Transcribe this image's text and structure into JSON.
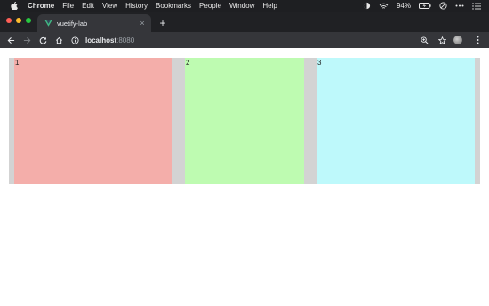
{
  "menubar": {
    "app_name": "Chrome",
    "items": [
      "File",
      "Edit",
      "View",
      "History",
      "Bookmarks",
      "People",
      "Window",
      "Help"
    ],
    "battery": "94%"
  },
  "tab": {
    "title": "vuetify-lab",
    "close_glyph": "×"
  },
  "new_tab_glyph": "+",
  "omnibox": {
    "host": "localhost",
    "port": ":8080"
  },
  "page": {
    "cells": [
      {
        "label": "1",
        "color": "#f4aeaa"
      },
      {
        "label": "2",
        "color": "#befbb1"
      },
      {
        "label": "3",
        "color": "#bef9fb"
      }
    ],
    "gutter_color": "#d3d3d3"
  },
  "colors": {
    "menubar_bg": "#1e1f22",
    "tabstrip_bg": "#202124",
    "toolbar_bg": "#35363a"
  },
  "icons": {
    "apple": "apple-icon",
    "vue_favicon": "vue-logo-icon",
    "back": "back-arrow-icon",
    "forward": "forward-arrow-icon",
    "reload": "reload-icon",
    "home": "home-icon",
    "info": "info-icon",
    "zoom": "zoom-icon",
    "bookmark": "star-icon"
  }
}
